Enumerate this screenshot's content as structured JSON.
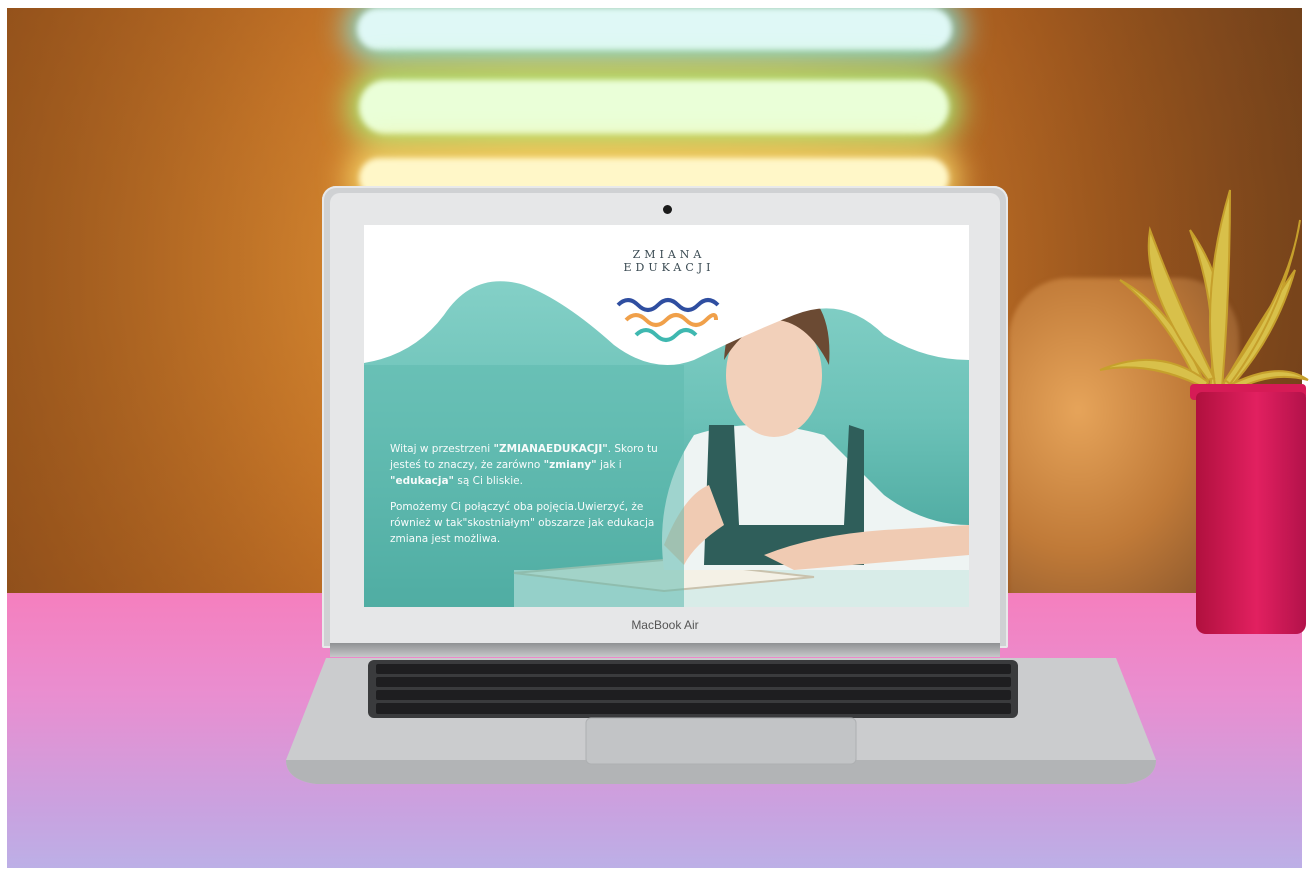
{
  "laptop": {
    "brand_label": "MacBook Air"
  },
  "website": {
    "logo_text": "ZMIANA EDUKACJI",
    "intro_part1": "Witaj w przestrzeni ",
    "intro_brand": "\"ZMIANAEDUKACJI\"",
    "intro_part2": ". Skoro tu jesteś to znaczy, że zarówno ",
    "intro_word1": "\"zmiany\"",
    "intro_part3": " jak i ",
    "intro_word2": "\"edukacja\"",
    "intro_part4": " są Ci bliskie.",
    "paragraph2": "Pomożemy Ci połączyć oba pojęcia.Uwierzyć, że również w tak\"skostniałym\" obszarze jak edukacja zmiana jest możliwa."
  },
  "colors": {
    "teal": "#7fcdc4",
    "wave_blue": "#2f4ea0",
    "wave_orange": "#f0a04a",
    "wave_teal": "#3fb8b0",
    "table_pink": "#f57fbe",
    "pot_red": "#e22060"
  }
}
